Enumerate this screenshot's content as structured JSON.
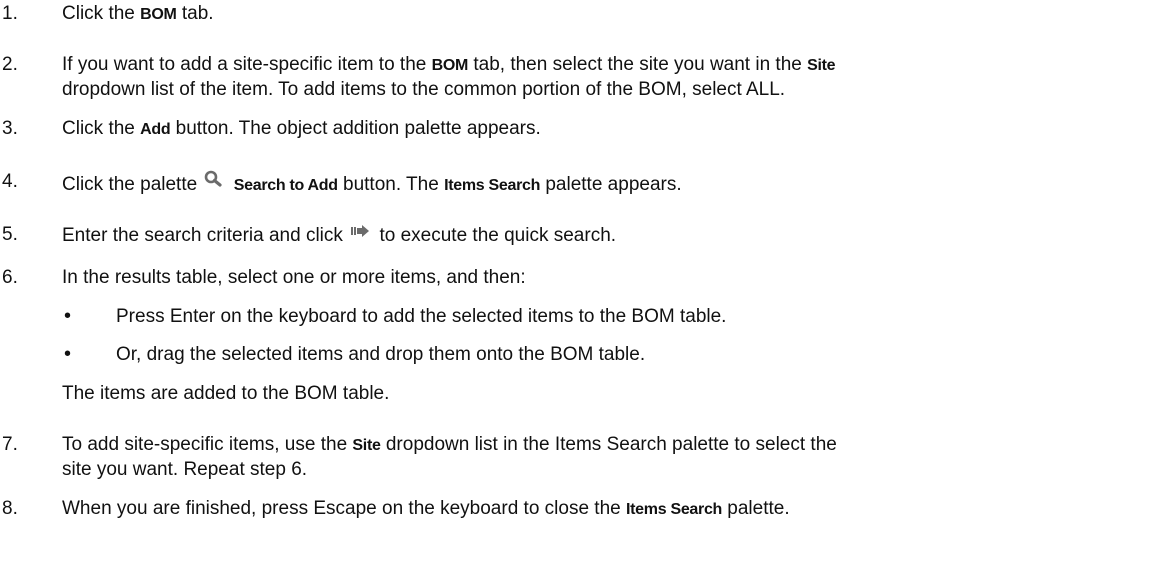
{
  "steps": [
    {
      "num": "1.",
      "parts": [
        "Click the ",
        "BOM",
        " tab."
      ]
    },
    {
      "num": "2.",
      "line1": [
        "If you want to add a site-specific item to the ",
        "BOM",
        " tab, then select the site you want in the ",
        "Site"
      ],
      "line2": "dropdown list of the item. To add items to the common portion of the BOM, select ALL."
    },
    {
      "num": "3.",
      "parts": [
        "Click the ",
        "Add",
        " button. The object addition palette appears."
      ]
    },
    {
      "num": "4.",
      "pre": "Click the palette ",
      "icon": "search-icon",
      "bold1": "Search to Add",
      "mid": " button. The ",
      "bold2": "Items Search",
      "post": " palette appears."
    },
    {
      "num": "5.",
      "pre": "Enter the search criteria and click ",
      "icon": "go-arrow-icon",
      "post": " to execute the quick search."
    },
    {
      "num": "6.",
      "text": "In the results table, select one or more items, and then:",
      "bullets": [
        "Press Enter on the keyboard to add the selected items to the BOM table.",
        "Or, drag the selected items and drop them onto the BOM table."
      ],
      "after": "The items are added to the BOM table."
    },
    {
      "num": "7.",
      "line1": [
        "To add site-specific items, use the ",
        "Site",
        " dropdown list in the Items Search palette to select the"
      ],
      "line2": "site you want. Repeat step 6."
    },
    {
      "num": "8.",
      "parts": [
        "When you are finished, press Escape on the keyboard to close the ",
        "Items Search",
        " palette."
      ]
    }
  ],
  "colors": {
    "text": "#111111",
    "icon": "#6b6b6b"
  }
}
